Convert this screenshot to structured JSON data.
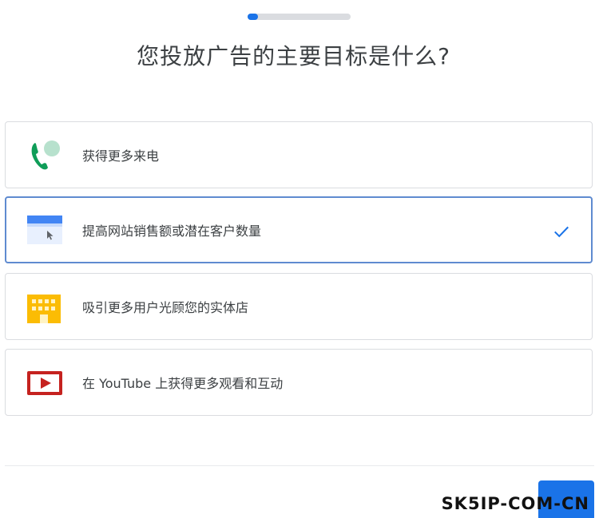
{
  "progress": {
    "fraction": 0.1
  },
  "title": "您投放广告的主要目标是什么?",
  "options": [
    {
      "label": "获得更多来电",
      "icon": "phone-call-icon",
      "selected": false
    },
    {
      "label": "提高网站销售额或潜在客户数量",
      "icon": "browser-window-icon",
      "selected": true
    },
    {
      "label": "吸引更多用户光顾您的实体店",
      "icon": "storefront-icon",
      "selected": false
    },
    {
      "label": "在 YouTube 上获得更多观看和互动",
      "icon": "youtube-play-icon",
      "selected": false
    }
  ],
  "watermark": "SK5IP-COM-CN",
  "colors": {
    "accent": "#1a73e8",
    "selected_border": "#5f8bd0",
    "phone_green": "#0f9d58",
    "building_yellow": "#fbbc04",
    "youtube_red": "#c5221f"
  }
}
